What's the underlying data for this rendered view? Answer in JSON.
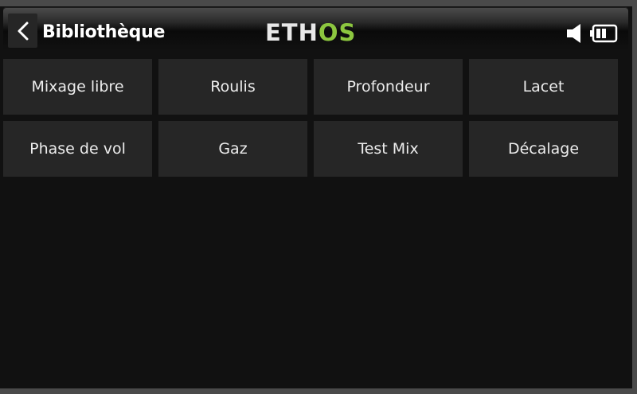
{
  "header": {
    "back_icon": "chevron-left-icon",
    "title": "Bibliothèque",
    "logo_part1": "ETH",
    "logo_part2": "OS",
    "logo_accent_color": "#8cc63f",
    "speaker_icon": "speaker-icon",
    "battery_icon": "battery-icon"
  },
  "library": {
    "items": [
      {
        "label": "Mixage libre"
      },
      {
        "label": "Roulis"
      },
      {
        "label": "Profondeur"
      },
      {
        "label": "Lacet"
      },
      {
        "label": "Phase de vol"
      },
      {
        "label": "Gaz"
      },
      {
        "label": "Test Mix"
      },
      {
        "label": "Décalage"
      }
    ]
  },
  "colors": {
    "background": "#111111",
    "tile": "#262626",
    "text": "#ececec"
  }
}
